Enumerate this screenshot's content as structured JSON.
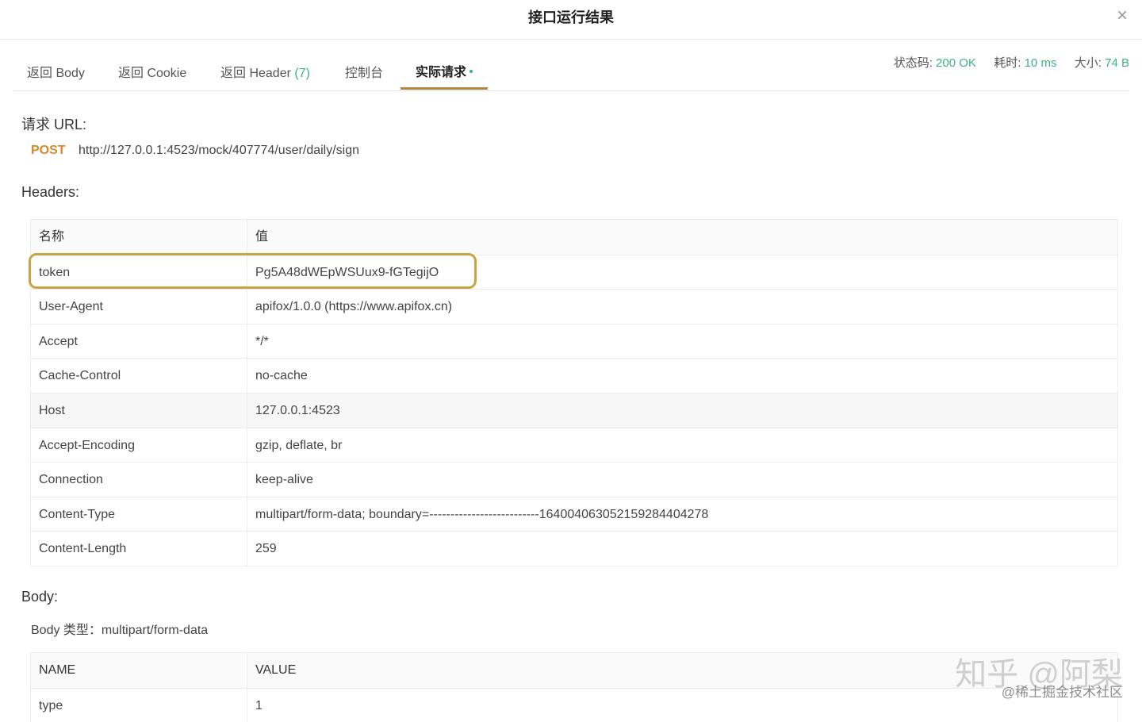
{
  "modal": {
    "title": "接口运行结果",
    "close_icon": "×"
  },
  "tabs": [
    {
      "label": "返回 Body",
      "count": ""
    },
    {
      "label": "返回 Cookie",
      "count": ""
    },
    {
      "label": "返回 Header",
      "count": "(7)"
    },
    {
      "label": "控制台",
      "count": ""
    },
    {
      "label": "实际请求",
      "count": ""
    }
  ],
  "active_tab_index": 4,
  "stats": {
    "status_label": "状态码:",
    "status_value": "200 OK",
    "time_label": "耗时:",
    "time_value": "10 ms",
    "size_label": "大小:",
    "size_value": "74 B"
  },
  "request": {
    "url_title": "请求 URL:",
    "method": "POST",
    "url": "http://127.0.0.1:4523/mock/407774/user/daily/sign"
  },
  "headers": {
    "title": "Headers:",
    "columns": [
      "名称",
      "值"
    ],
    "rows": [
      {
        "name": "token",
        "value": "Pg5A48dWEpWSUux9-fGTegijO"
      },
      {
        "name": "User-Agent",
        "value": "apifox/1.0.0 (https://www.apifox.cn)"
      },
      {
        "name": "Accept",
        "value": "*/*"
      },
      {
        "name": "Cache-Control",
        "value": "no-cache"
      },
      {
        "name": "Host",
        "value": "127.0.0.1:4523"
      },
      {
        "name": "Accept-Encoding",
        "value": "gzip, deflate, br"
      },
      {
        "name": "Connection",
        "value": "keep-alive"
      },
      {
        "name": "Content-Type",
        "value": "multipart/form-data; boundary=--------------------------164004063052159284404278"
      },
      {
        "name": "Content-Length",
        "value": "259"
      }
    ]
  },
  "body": {
    "title": "Body:",
    "type_line": "Body 类型：multipart/form-data",
    "columns": [
      "NAME",
      "VALUE"
    ],
    "rows": [
      {
        "name": "type",
        "value": "1"
      }
    ]
  },
  "watermark": {
    "line1": "知乎 @阿梨",
    "line2": "@稀土掘金技术社区"
  },
  "colors": {
    "accent": "#b8863b",
    "success": "#3fb27f",
    "method": "#d48a2b",
    "highlight_border": "#c9a443"
  }
}
